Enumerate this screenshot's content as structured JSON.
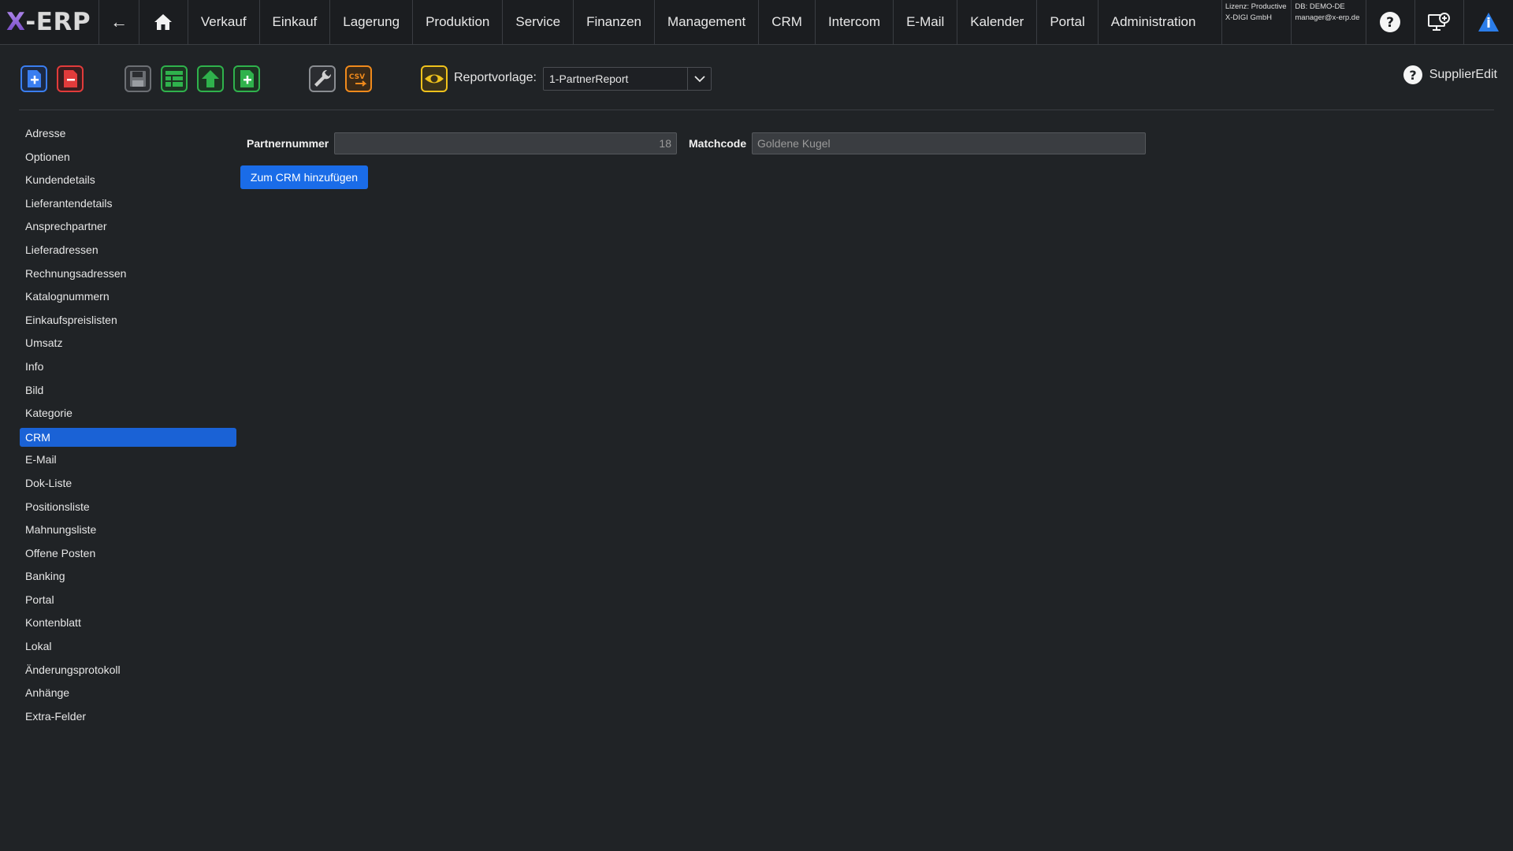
{
  "app": {
    "logo": "-ERP",
    "logo_x": "X"
  },
  "nav": {
    "back": "←",
    "items": [
      "Verkauf",
      "Einkauf",
      "Lagerung",
      "Produktion",
      "Service",
      "Finanzen",
      "Management",
      "CRM",
      "Intercom",
      "E-Mail",
      "Kalender",
      "Portal",
      "Administration"
    ],
    "license_line1": "Lizenz: Productive",
    "license_line2": "X-DIGI GmbH",
    "db_line1": "DB: DEMO-DE",
    "db_line2": "manager@x-erp.de"
  },
  "toolbar": {
    "report_label": "Reportvorlage:",
    "report_value": "1-PartnerReport",
    "help_label": "SupplierEdit",
    "csv_label": "CSV"
  },
  "sidebar": {
    "items": [
      "Adresse",
      "Optionen",
      "Kundendetails",
      "Lieferantendetails",
      "Ansprechpartner",
      "Lieferadressen",
      "Rechnungsadressen",
      "Katalognummern",
      "Einkaufspreislisten",
      "Umsatz",
      "Info",
      "Bild",
      "Kategorie",
      "CRM",
      "E-Mail",
      "Dok-Liste",
      "Positionsliste",
      "Mahnungsliste",
      "Offene Posten",
      "Banking",
      "Portal",
      "Kontenblatt",
      "Lokal",
      "Änderungsprotokoll",
      "Anhänge",
      "Extra-Felder"
    ],
    "active": "CRM"
  },
  "form": {
    "partnernummer_label": "Partnernummer",
    "partnernummer_value": "18",
    "matchcode_label": "Matchcode",
    "matchcode_value": "Goldene Kugel",
    "crm_button": "Zum CRM hinzufügen"
  },
  "colors": {
    "accent": "#1a6ce8",
    "active_item": "#1a62d6",
    "background": "#202326"
  }
}
